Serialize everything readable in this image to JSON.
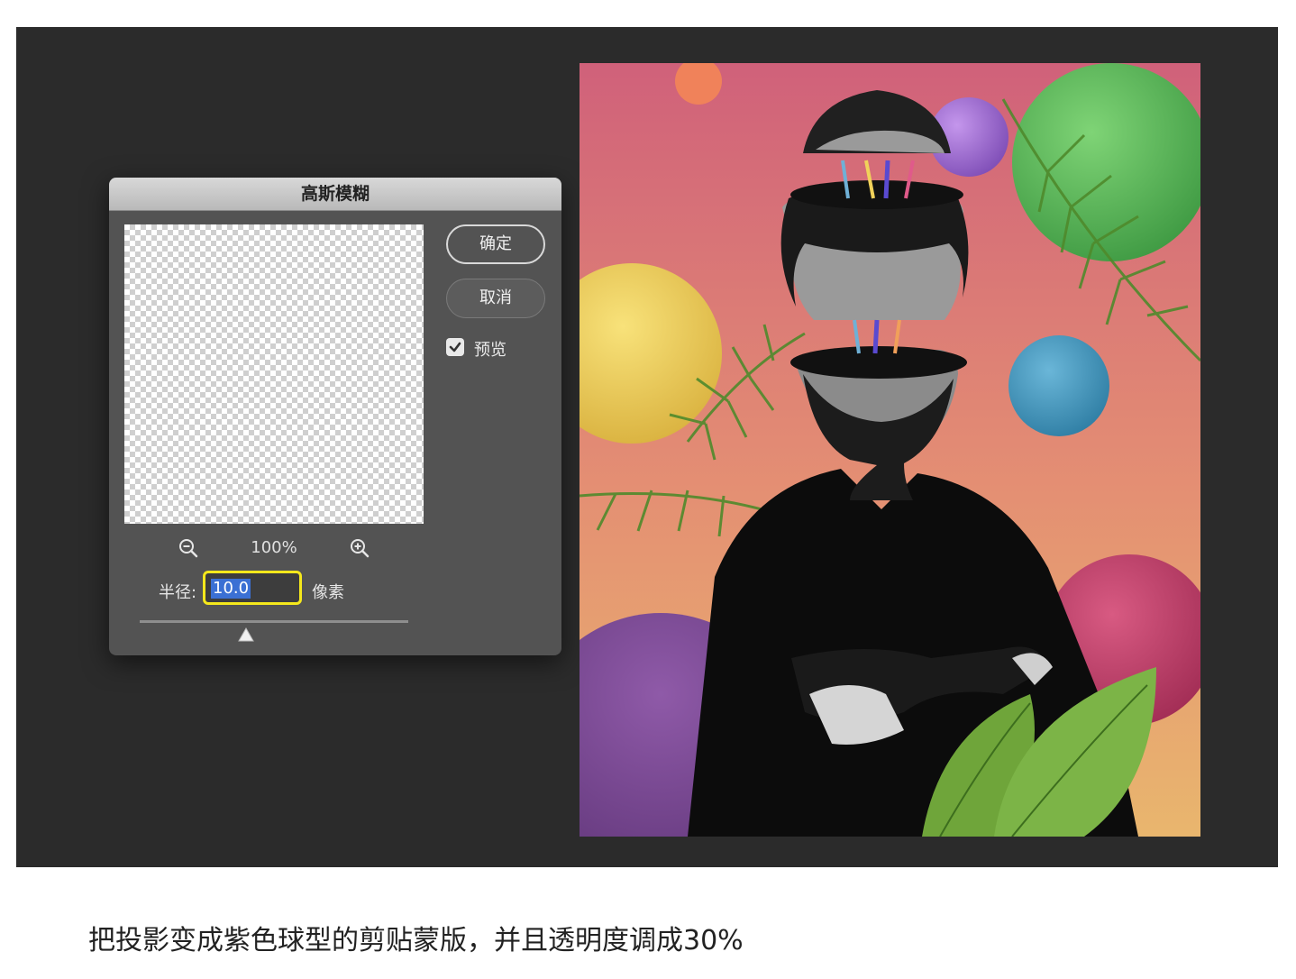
{
  "dialog": {
    "title": "高斯模糊",
    "zoom_level": "100%",
    "zoom_out_icon": "zoom-out-icon",
    "zoom_in_icon": "zoom-in-icon",
    "radius_label": "半径:",
    "radius_value": "10.0",
    "radius_unit": "像素",
    "slider_level": 0.35,
    "ok_label": "确定",
    "cancel_label": "取消",
    "preview_label": "预览",
    "preview_checked": true,
    "highlight_color": "#f5e81c",
    "selection_color": "#3b70d4"
  },
  "artwork": {
    "colors": {
      "background_top": "#d0617a",
      "background_bottom": "#e9b66e",
      "sphere_green": "#6fc766",
      "sphere_purple": "#a874d6",
      "sphere_yellow": "#f1d25a",
      "sphere_blue": "#4ea1c6",
      "sphere_magenta": "#c8406a",
      "sphere_violet": "#7b4a93",
      "sphere_orange": "#f0825a"
    }
  },
  "caption": "把投影变成紫色球型的剪贴蒙版，并且透明度调成30%"
}
